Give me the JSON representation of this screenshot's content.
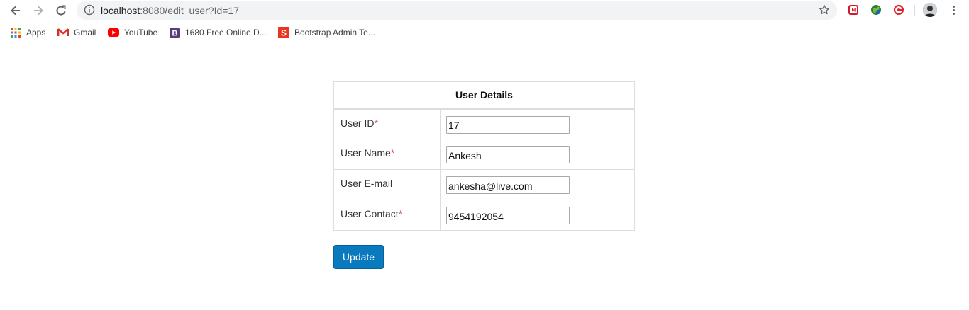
{
  "browser": {
    "url_host": "localhost",
    "url_path": ":8080/edit_user?Id=17",
    "bookmarks": [
      {
        "label": "Apps",
        "icon": "apps-grid-icon"
      },
      {
        "label": "Gmail",
        "icon": "gmail-icon"
      },
      {
        "label": "YouTube",
        "icon": "youtube-icon"
      },
      {
        "label": "1680 Free Online D...",
        "icon": "bootstrap-icon"
      },
      {
        "label": "Bootstrap Admin Te...",
        "icon": "s-logo-icon"
      }
    ]
  },
  "form": {
    "title": "User Details",
    "rows": [
      {
        "label": "User ID",
        "required": "*",
        "value": "17"
      },
      {
        "label": "User Name",
        "required": "*",
        "value": "Ankesh"
      },
      {
        "label": "User E-mail",
        "required": "",
        "value": "ankesha@live.com"
      },
      {
        "label": "User Contact",
        "required": "*",
        "value": "9454192054"
      }
    ],
    "submit_label": "Update"
  },
  "colors": {
    "button": "#0a7abf",
    "required": "#d9534f",
    "border": "#dddddd"
  }
}
